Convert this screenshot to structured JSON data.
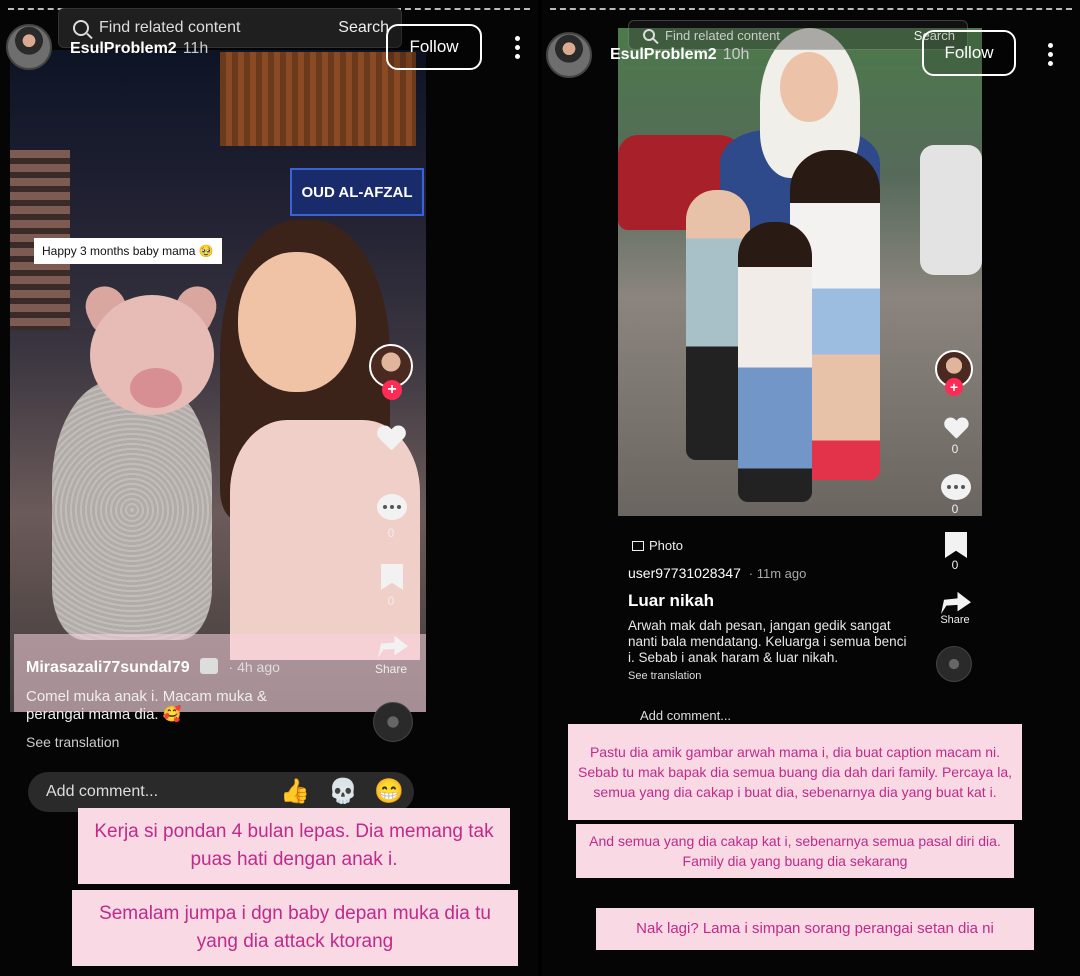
{
  "left_story": {
    "username": "EsulProblem2",
    "time": "11h",
    "follow_label": "Follow",
    "search": {
      "placeholder": "Find related content",
      "button": "Search"
    },
    "photo": {
      "shop_sign": "OUD AL-AFZAL",
      "sticker": "Happy 3 months baby mama 🥹"
    },
    "rail": {
      "likes": "",
      "comments": "0",
      "saves": "0",
      "share_label": "Share"
    },
    "post": {
      "author": "Mirasazali77sundal79",
      "time": "· 4h ago",
      "caption_line1": "Comel muka anak i. Macam muka &",
      "caption_line2": "perangai mama dia. 🥰",
      "see_translation": "See translation"
    },
    "comment_placeholder": "Add comment...",
    "emojis": [
      "👍",
      "💀",
      "😁"
    ],
    "overlay_texts": [
      "Kerja si pondan 4 bulan lepas. Dia memang tak puas hati dengan anak i.",
      "Semalam jumpa i dgn baby depan muka dia tu yang dia attack ktorang"
    ]
  },
  "right_story": {
    "username": "EsulProblem2",
    "time": "10h",
    "follow_label": "Follow",
    "search": {
      "placeholder": "Find related content",
      "button": "Search"
    },
    "rail": {
      "likes": "0",
      "comments": "0",
      "saves": "0",
      "share_label": "Share"
    },
    "post": {
      "badge": "Photo",
      "author": "user97731028347",
      "time": "· 11m ago",
      "title": "Luar nikah",
      "body": "Arwah mak dah pesan, jangan gedik sangat nanti bala mendatang. Keluarga i semua benci i. Sebab i anak haram & luar nikah.",
      "see_translation": "See translation"
    },
    "comment_placeholder": "Add comment...",
    "overlay_texts": [
      "Pastu dia amik gambar arwah mama i, dia buat caption macam ni. Sebab tu mak bapak dia semua buang dia dah dari family. Percaya la, semua yang dia cakap i buat dia, sebenarnya dia yang buat kat i.",
      "And semua yang dia cakap kat i, sebenarnya semua pasal diri dia. Family dia yang buang dia sekarang",
      "Nak lagi? Lama i simpan sorang perangai setan dia ni"
    ]
  },
  "colors": {
    "overlay_bg": "#f8d9e4",
    "overlay_text": "#c02a8a",
    "tiktok_red": "#fe2c55"
  }
}
